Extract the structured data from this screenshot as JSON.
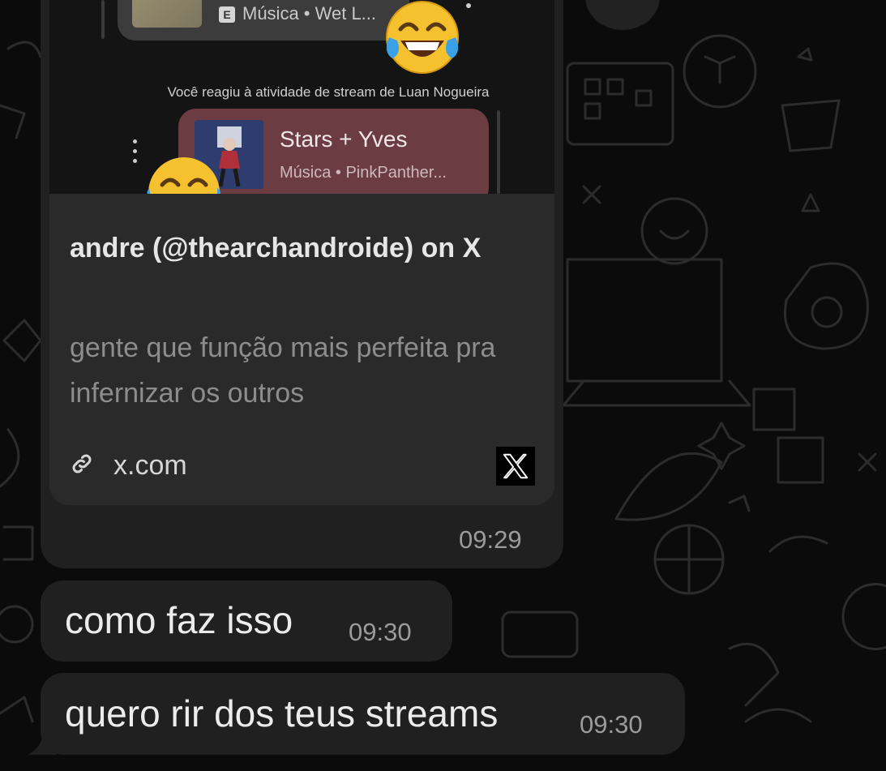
{
  "theme": {
    "bubble_color": "#202020",
    "card_color": "#2a2a2a",
    "music_card_color": "#6b3c42",
    "text_color": "#ececec",
    "muted_text_color": "#8d8d8d"
  },
  "preview": {
    "embed_badge": "E",
    "embed_text": "Música • Wet L...",
    "reacted_line": "Você reagiu à atividade de stream de Luan Nogueira",
    "music_title": "Stars + Yves",
    "music_subtitle": "Música • PinkPanther...",
    "reaction_icon": "laughing-tears-emoji"
  },
  "link_preview": {
    "title": "andre (@thearchandroide) on X",
    "description": "gente que função mais perfeita pra infernizar os outros",
    "domain": "x.com",
    "link_icon": "link-icon",
    "site_logo": "x-logo-icon"
  },
  "messages": [
    {
      "text": "",
      "time": "09:29"
    },
    {
      "text": "como faz isso",
      "time": "09:30"
    },
    {
      "text": "quero rir dos teus streams",
      "time": "09:30"
    }
  ]
}
